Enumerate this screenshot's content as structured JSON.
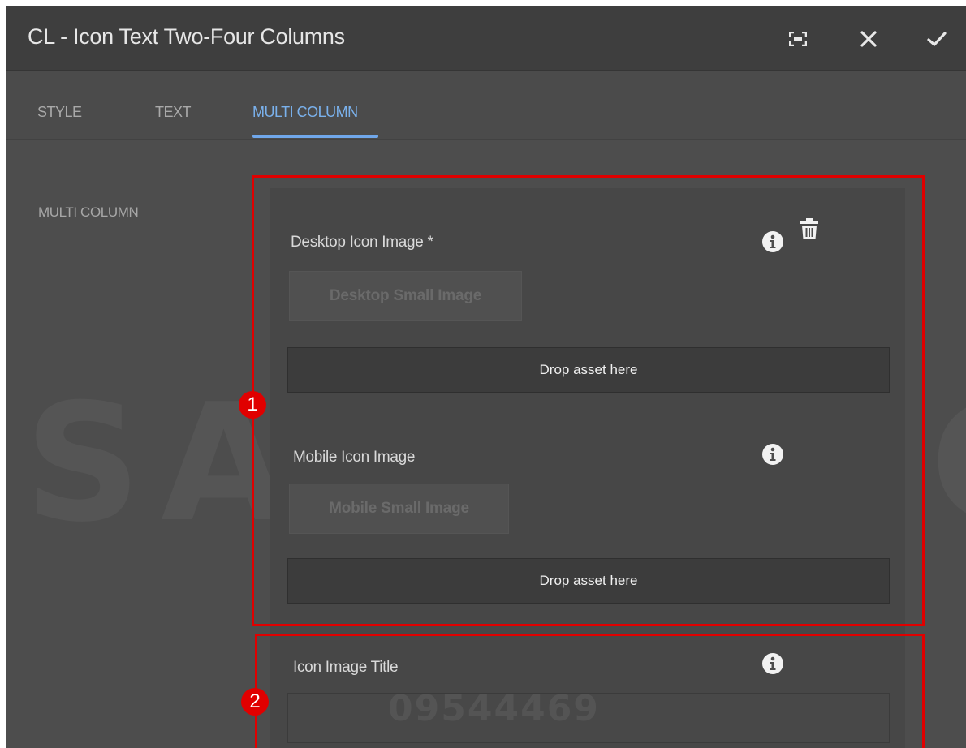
{
  "dialog": {
    "title": "CL - Icon Text Two-Four Columns",
    "actions": [
      {
        "name": "fullscreen",
        "icon": "fullscreen-icon"
      },
      {
        "name": "close",
        "icon": "close-icon"
      },
      {
        "name": "done",
        "icon": "checkmark-icon"
      }
    ]
  },
  "tabs": [
    {
      "label": "STYLE",
      "active": false
    },
    {
      "label": "TEXT",
      "active": false
    },
    {
      "label": "MULTI COLUMN",
      "active": true
    }
  ],
  "section": {
    "label": "MULTI COLUMN"
  },
  "watermark": {
    "text": "SAMSUNG",
    "code": "09544469"
  },
  "annotations": [
    {
      "number": "1",
      "color": "#e00000"
    },
    {
      "number": "2",
      "color": "#e00000"
    }
  ],
  "fields": {
    "desktop_icon": {
      "label": "Desktop Icon Image *",
      "button": "Desktop Small Image",
      "drop": "Drop asset here"
    },
    "mobile_icon": {
      "label": "Mobile Icon Image",
      "button": "Mobile Small Image",
      "drop": "Drop asset here"
    },
    "icon_title": {
      "label": "Icon Image Title",
      "value": ""
    }
  },
  "colors": {
    "accent": "#70a7ea",
    "annotation": "#e00000",
    "header_bg": "#3e3e3e",
    "panel_bg": "#4d4d4d"
  }
}
